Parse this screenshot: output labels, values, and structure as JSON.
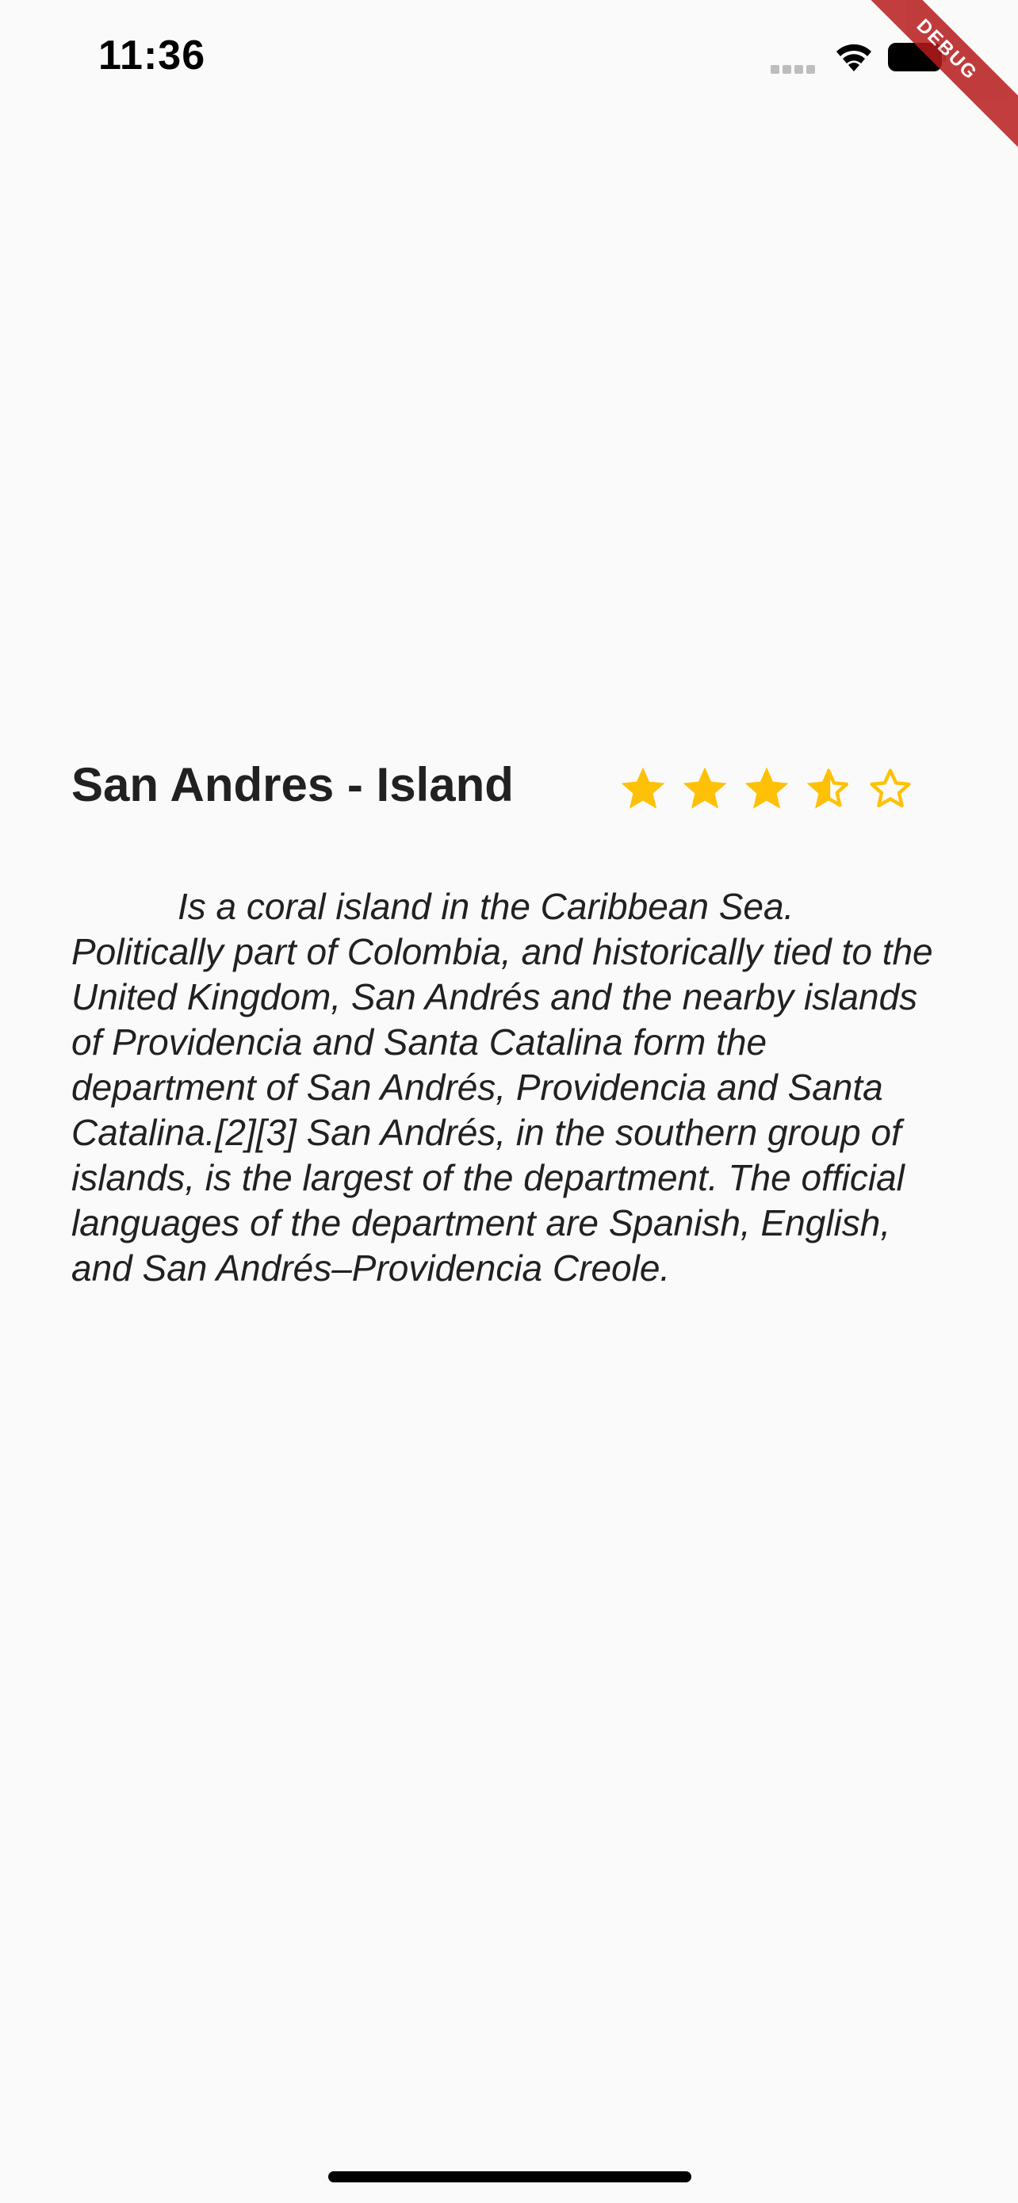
{
  "status_bar": {
    "time": "11:36",
    "signal_icon": "cellular-signal-icon",
    "wifi_icon": "wifi-icon",
    "battery_icon": "battery-icon"
  },
  "debug_banner": {
    "label": "DEBUG",
    "color": "#b71c1c"
  },
  "place": {
    "title": "San Andres - Island",
    "rating": {
      "value": 3.5,
      "max": 5,
      "color": "#ffc107"
    },
    "description": "Is a coral island in the Caribbean Sea. Politically part of Colombia, and historically tied to the United Kingdom, San Andrés and the nearby islands of Providencia and Santa Catalina form the department of San Andrés, Providencia and Santa Catalina.[2][3] San Andrés, in the southern group of islands, is the largest of the department. The official languages of the department are Spanish, English, and San Andrés–Providencia Creole."
  }
}
